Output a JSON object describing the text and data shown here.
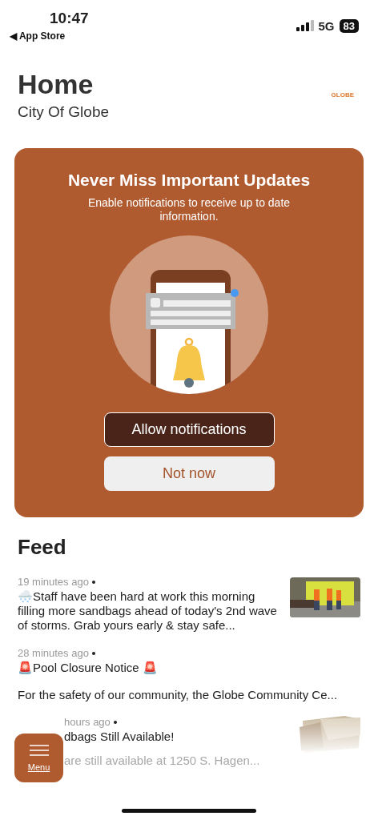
{
  "status_bar": {
    "time": "10:47",
    "back": "◀ App Store",
    "network": "5G",
    "battery": "83"
  },
  "header": {
    "title": "Home",
    "subtitle": "City Of Globe",
    "logo": "GLOBE"
  },
  "prompt": {
    "title": "Never Miss Important Updates",
    "text": "Enable notifications to receive up to date information.",
    "buttons": [
      {
        "label": "Allow notifications",
        "kind": "primary"
      },
      {
        "label": "Not now",
        "kind": "secondary"
      }
    ]
  },
  "feed": {
    "title": "Feed",
    "items": [
      {
        "time": "19 minutes ago",
        "emoji": "🌨️",
        "text": "Staff have been hard at work this morning filling more sandbags ahead of today's 2nd wave of storms. Grab yours early & stay safe...",
        "covered": false
      },
      {
        "time": "28 minutes ago",
        "emoji": "🚨",
        "text": "Pool Closure Notice 🚨",
        "body": "For the safety of our community, the Globe Community Ce...",
        "covered": false
      },
      {
        "time": "hours ago",
        "text": "dbags Still Available!",
        "body": "are still available at 1250 S. Hagen...",
        "covered": true
      }
    ]
  },
  "menu_button": {
    "label": "Menu"
  }
}
